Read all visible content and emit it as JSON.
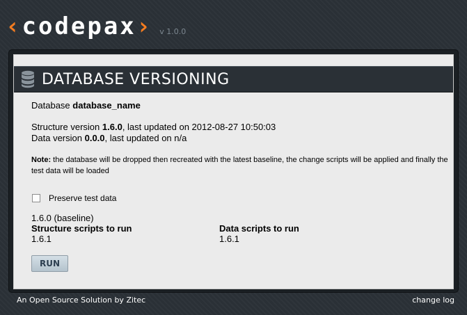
{
  "header": {
    "logo_open": "‹",
    "logo_text": "codepax",
    "logo_close": "›",
    "version": "v 1.0.0",
    "accent_color": "#f47c20"
  },
  "panel": {
    "icon": "database-icon",
    "title": "DATABASE VERSIONING"
  },
  "database": {
    "label": "Database",
    "name": "database_name"
  },
  "structure": {
    "label": "Structure version",
    "version": "1.6.0",
    "updated_text": ", last updated on 2012-08-27 10:50:03"
  },
  "data_version": {
    "label": "Data version",
    "version": "0.0.0",
    "updated_text": ", last updated on n/a"
  },
  "note": {
    "label": "Note:",
    "text": " the database will be dropped then recreated with the latest baseline, the change scripts will be applied and finally the test data will be loaded"
  },
  "options": {
    "preserve_label": "Preserve test data",
    "preserve_checked": false
  },
  "baseline": "1.6.0 (baseline)",
  "scripts": {
    "structure_header": "Structure scripts to run",
    "structure_items": [
      "1.6.1"
    ],
    "data_header": "Data scripts to run",
    "data_items": [
      "1.6.1"
    ]
  },
  "run_label": "RUN",
  "footer": {
    "credit": "An Open Source Solution by Zitec",
    "changelog": "change log"
  }
}
